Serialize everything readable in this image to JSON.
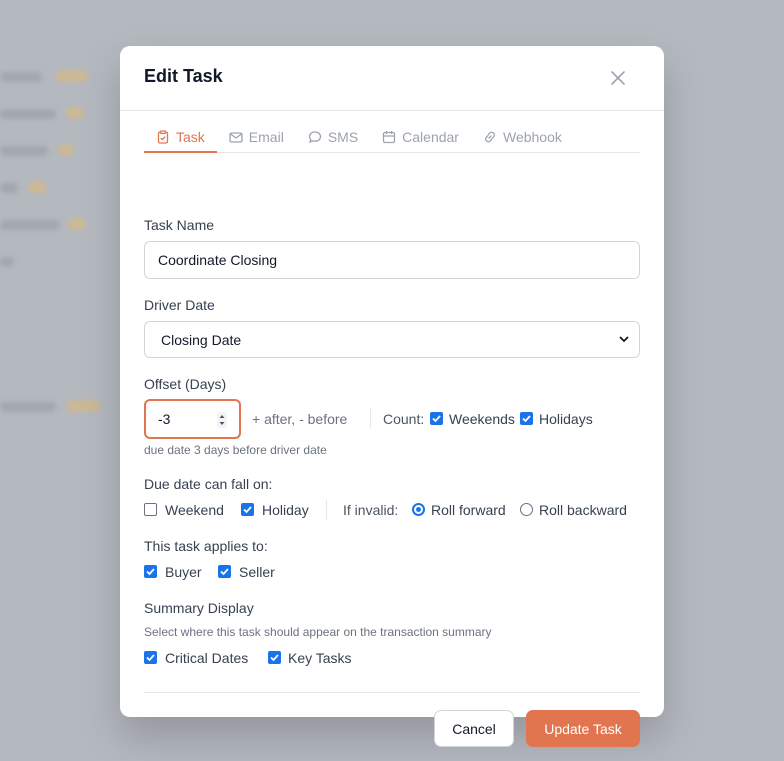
{
  "modal": {
    "title": "Edit Task",
    "tabs": [
      {
        "label": "Task",
        "icon": "clipboard-icon",
        "active": true
      },
      {
        "label": "Email",
        "icon": "mail-icon",
        "active": false
      },
      {
        "label": "SMS",
        "icon": "chat-bubble-icon",
        "active": false
      },
      {
        "label": "Calendar",
        "icon": "calendar-icon",
        "active": false
      },
      {
        "label": "Webhook",
        "icon": "link-icon",
        "active": false
      }
    ]
  },
  "form": {
    "task_name_label": "Task Name",
    "task_name_value": "Coordinate Closing",
    "driver_date_label": "Driver Date",
    "driver_date_value": "Closing Date",
    "offset_label": "Offset (Days)",
    "offset_value": "-3",
    "offset_hint": "+ after, - before",
    "count_label": "Count:",
    "count_weekends": "Weekends",
    "count_holidays": "Holidays",
    "offset_description": "due date 3 days before driver date",
    "due_fall_label": "Due date can fall on:",
    "fall_weekend": "Weekend",
    "fall_holiday": "Holiday",
    "if_invalid_label": "If invalid:",
    "roll_forward": "Roll forward",
    "roll_backward": "Roll backward",
    "applies_label": "This task applies to:",
    "applies_buyer": "Buyer",
    "applies_seller": "Seller",
    "summary_label": "Summary Display",
    "summary_description": "Select where this task should appear on the transaction summary",
    "summary_critical": "Critical Dates",
    "summary_key": "Key Tasks"
  },
  "footer": {
    "cancel_label": "Cancel",
    "submit_label": "Update Task"
  },
  "colors": {
    "accent": "#e07550",
    "checkbox": "#1a73e8"
  }
}
